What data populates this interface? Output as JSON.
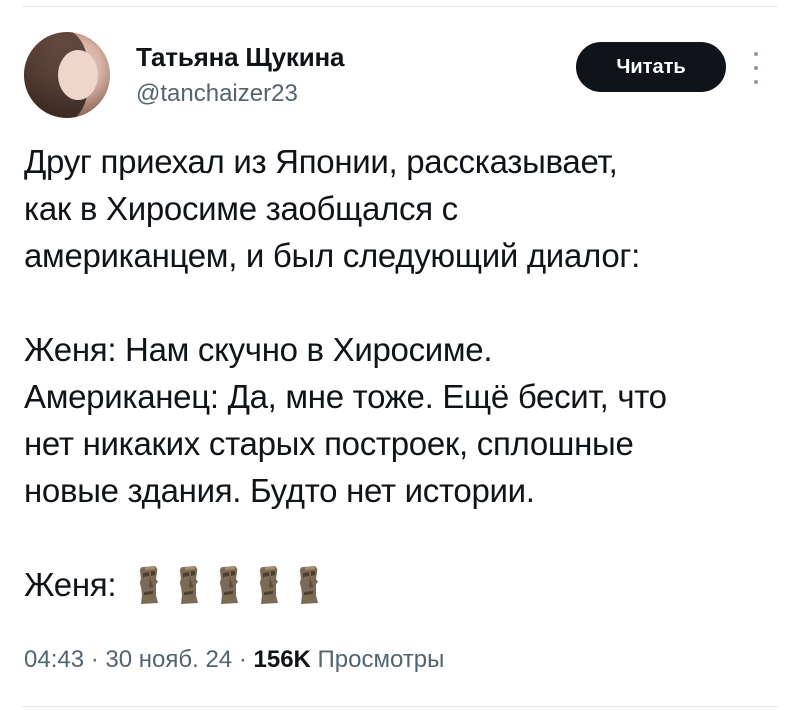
{
  "author": {
    "name": "Татьяна Щукина",
    "handle": "@tanchaizer23"
  },
  "follow_button": {
    "label": "Читать"
  },
  "more_icon": "more-vertical-icon",
  "tweet": {
    "paragraph1": [
      "Друг приехал из Японии, рассказывает,",
      "как в Хиросиме заобщался с",
      "американцем, и был следующий диалог:"
    ],
    "paragraph2": [
      "Женя: Нам скучно в Хиросиме.",
      "Американец: Да, мне тоже. Ещё бесит, что",
      "нет никаких старых построек, сплошные",
      "новые здания. Будто нет истории."
    ],
    "last_line_prefix": "Женя:",
    "emoji": [
      "moai-icon",
      "moai-icon",
      "moai-icon",
      "moai-icon",
      "moai-icon"
    ]
  },
  "meta": {
    "time": "04:43",
    "separator": "·",
    "date": "30 нояб. 24",
    "views_count": "156K",
    "views_label": "Просмотры"
  }
}
